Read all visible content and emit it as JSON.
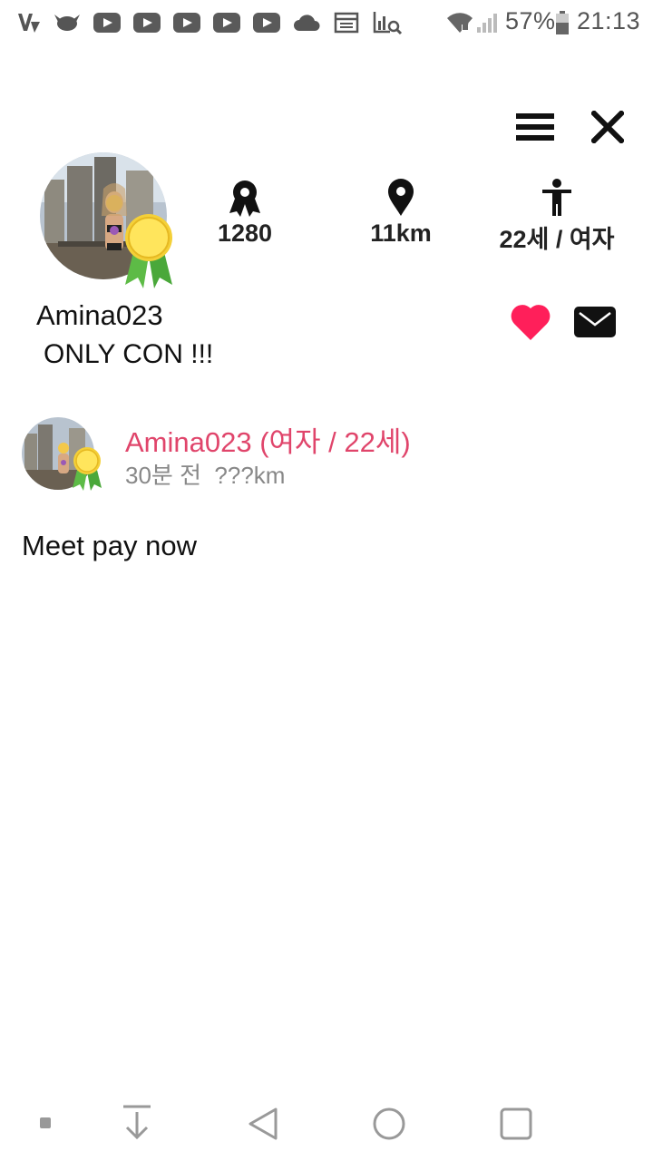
{
  "status_bar": {
    "battery": "57%",
    "time": "21:13",
    "icons": [
      "vpn-icon",
      "bird-icon",
      "youtube-icon",
      "youtube-icon",
      "youtube-icon",
      "youtube-icon",
      "youtube-icon",
      "cloud-icon",
      "calendar-icon",
      "chart-search-icon",
      "wifi-icon",
      "signal-icon",
      "battery-icon"
    ]
  },
  "toolbar": {
    "icons": [
      "menu-icon",
      "close-icon"
    ]
  },
  "profile": {
    "stats": [
      {
        "icon": "award-icon",
        "value": "1280"
      },
      {
        "icon": "location-pin-icon",
        "value": "11km"
      },
      {
        "icon": "person-icon",
        "value": "22세 / 여자"
      }
    ],
    "username": "Amina023",
    "status_message": "ONLY CON !!!",
    "actions": [
      "heart-icon",
      "mail-icon"
    ],
    "accent_color": "#ff1f5a"
  },
  "post": {
    "title": "Amina023 (여자 / 22세)",
    "meta": "30분 전  ???km",
    "body": "Meet pay now",
    "title_color": "#e0456b"
  },
  "navbar": {
    "icons": [
      "square-dot-icon",
      "download-icon",
      "back-icon",
      "home-icon",
      "recents-icon"
    ]
  }
}
